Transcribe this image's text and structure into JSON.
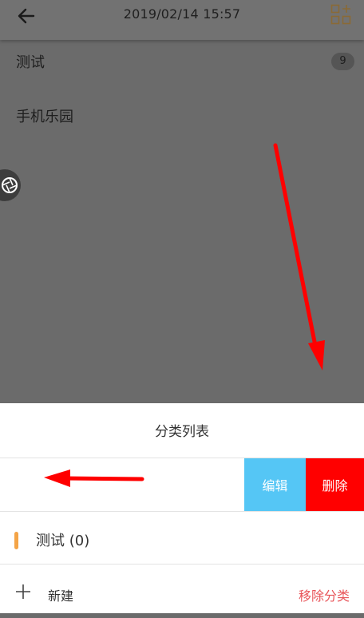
{
  "header": {
    "title": "2019/02/14 15:57",
    "back_icon": "arrow-left-icon",
    "add_icon": "grid-add-icon"
  },
  "notes": [
    {
      "label": "测试",
      "count": "9"
    },
    {
      "label": "手机乐园"
    }
  ],
  "sheet": {
    "title": "分类列表",
    "swiped_row": {
      "visible_text": ")",
      "edit_label": "编辑",
      "delete_label": "删除"
    },
    "categories": [
      {
        "label": "测试",
        "count_text": "(0)",
        "marker_color": "#f4a447"
      }
    ],
    "footer": {
      "new_label": "新建",
      "remove_label": "移除分类"
    }
  },
  "colors": {
    "edit": "#55c6f5",
    "delete": "#ff0000",
    "remove_text": "#e8555a",
    "annotation_arrow": "#ff0000"
  }
}
